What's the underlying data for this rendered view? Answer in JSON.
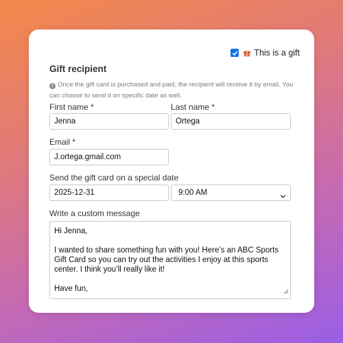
{
  "gift_toggle": {
    "checked": true,
    "label": "This is a gift"
  },
  "title": "Gift recipient",
  "info_text": "Once the gift card is purchased and paid, the recipient will receive it by email. You can choose to send it on specific date as well.",
  "first_name": {
    "label": "First name *",
    "value": "Jenna"
  },
  "last_name": {
    "label": "Last name *",
    "value": "Ortega"
  },
  "email": {
    "label": "Email *",
    "value": "J.ortega.gmail.com"
  },
  "send_date": {
    "label": "Send the gift card on a special date",
    "date_value": "2025-12-31",
    "time_value": "9:00 AM"
  },
  "message": {
    "label": "Write a custom message",
    "paragraphs": [
      "Hi Jenna,",
      "I wanted to share something fun with you! Here’s an ABC Sports Gift Card so you can try out the activities I enjoy at this sports center. I think you’ll really like it!",
      "Have fun,"
    ]
  },
  "colors": {
    "accent": "#1a73e8",
    "card": "#ffffff"
  }
}
